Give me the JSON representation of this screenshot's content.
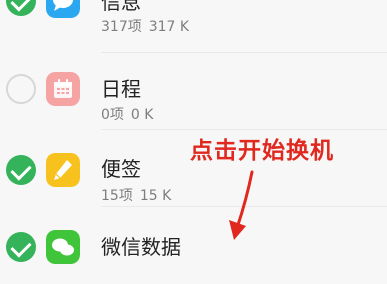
{
  "items": [
    {
      "title": "信息",
      "count": "317项",
      "size": "317 K",
      "checked": true,
      "icon": "message-icon",
      "icon_color": "#29a7f0"
    },
    {
      "title": "日程",
      "count": "0项",
      "size": "0 K",
      "checked": false,
      "icon": "calendar-icon",
      "icon_color": "#f5a3a3"
    },
    {
      "title": "便签",
      "count": "15项",
      "size": "15 K",
      "checked": true,
      "icon": "notes-icon",
      "icon_color": "#f7c21e"
    },
    {
      "title": "微信数据",
      "count": "",
      "size": "",
      "checked": true,
      "icon": "wechat-icon",
      "icon_color": "#3fc43a"
    }
  ],
  "annotation": {
    "text": "点击开始换机",
    "color": "#e0281f"
  },
  "colors": {
    "check_on": "#34b35b",
    "check_off_border": "#d7d7d7",
    "background": "#f7f7f7"
  }
}
